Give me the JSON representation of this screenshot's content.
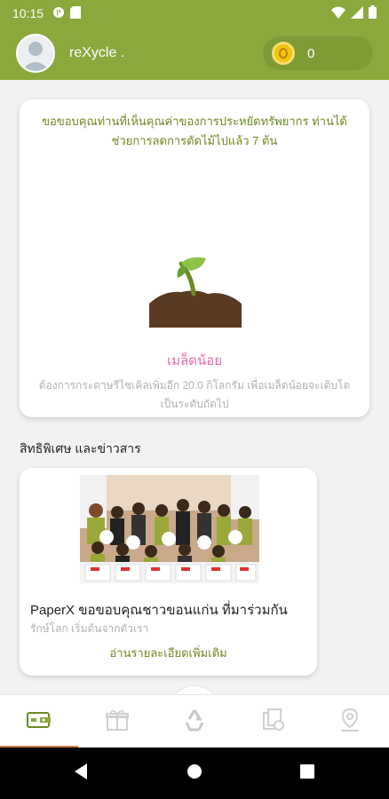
{
  "status_bar": {
    "time": "10:15",
    "icons": [
      "notification-icon",
      "sd-card-icon",
      "wifi-icon",
      "signal-icon",
      "battery-icon"
    ]
  },
  "header": {
    "username": "reXycle .",
    "coins": "0",
    "avatar_icon": "user-avatar-icon",
    "coin_icon": "coin-icon"
  },
  "tree_card": {
    "message": "ขอขอบคุณท่านที่เห็นคุณค่าของการประหยัดทรัพยากร ท่านได้ช่วยการลดการตัดไม้ไปแล้ว 7 ต้น",
    "level_name": "เมล็ดน้อย",
    "level_description": "ต้องการกระดาษรีไซเคิลเพิ่มอีก 20.0 กิโลกรัม เพื่อเมล็ดน้อยจะเติบโตเป็นระดับถัดไป"
  },
  "news_section": {
    "title": "สิทธิพิเศษ และข่าวสาร",
    "item": {
      "title": "PaperX ขอขอบคุณชาวขอนแก่น ที่มาร่วมกัน",
      "subtitle": "รักษ์โลก เริ่มต้นจากตัวเรา",
      "link": "อ่านรายละเอียดเพิ่มเติม"
    }
  },
  "bottom_nav": {
    "items": [
      "wallet-icon",
      "gift-icon",
      "recycle-icon",
      "document-icon",
      "location-icon"
    ],
    "active_index": 0
  },
  "colors": {
    "brand_green": "#8aa83c",
    "text_green": "#6b8a23",
    "level_pink": "#e86aa6",
    "active_tab": "#c97f4a"
  }
}
